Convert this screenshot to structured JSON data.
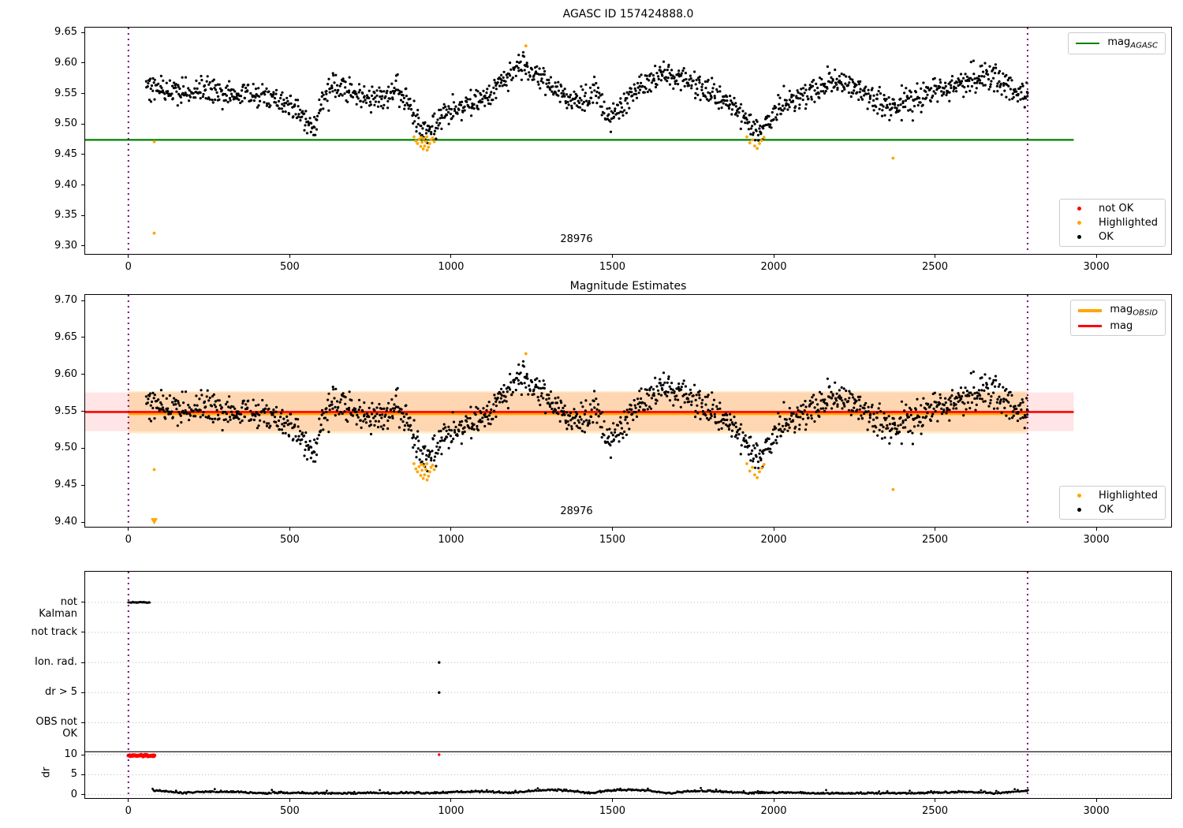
{
  "figure": {
    "background": "#ffffff",
    "accent_colors": {
      "ok_black": "#000000",
      "highlight_orange": "#ffa500",
      "not_ok_red": "#ff0000",
      "agasc_green": "#008000",
      "obsid_vline_purple": "#800080",
      "grid_gray": "#b5b5b5"
    }
  },
  "chart_data": [
    {
      "type": "scatter",
      "title": "AGASC ID 157424888.0",
      "xlim": [
        -134,
        3232
      ],
      "ylim": [
        9.287,
        9.658
      ],
      "xtick_values": [
        0,
        500,
        1000,
        1500,
        2000,
        2500,
        3000
      ],
      "xtick_labels": [
        "0",
        "500",
        "1000",
        "1500",
        "2000",
        "2500",
        "3000"
      ],
      "ytick_values": [
        9.3,
        9.35,
        9.4,
        9.45,
        9.5,
        9.55,
        9.6,
        9.65
      ],
      "ytick_labels": [
        "9.30",
        "9.35",
        "9.40",
        "9.45",
        "9.50",
        "9.55",
        "9.60",
        "9.65"
      ],
      "obsid_label": {
        "text": "28976",
        "x": 1390,
        "y": 9.308
      },
      "vlines": [
        {
          "x": 0
        },
        {
          "x": 2787
        }
      ],
      "vline_color": "#800080",
      "hlines": [
        {
          "name": "mag-agasc-line",
          "y": 9.474,
          "x0": -134,
          "x1": 2930,
          "color": "#008000",
          "width": 2.2
        }
      ],
      "ok_series": {
        "name": "OK",
        "color": "#000000",
        "sigma": 0.0105,
        "n": 1500,
        "x_start": 55,
        "x_end": 2788,
        "seed": 42,
        "trend": [
          [
            55,
            9.562
          ],
          [
            120,
            9.556
          ],
          [
            200,
            9.555
          ],
          [
            280,
            9.552
          ],
          [
            360,
            9.548
          ],
          [
            430,
            9.543
          ],
          [
            470,
            9.537
          ],
          [
            510,
            9.528
          ],
          [
            545,
            9.508
          ],
          [
            570,
            9.492
          ],
          [
            585,
            9.508
          ],
          [
            600,
            9.545
          ],
          [
            630,
            9.556
          ],
          [
            665,
            9.559
          ],
          [
            695,
            9.552
          ],
          [
            720,
            9.543
          ],
          [
            760,
            9.541
          ],
          [
            800,
            9.548
          ],
          [
            840,
            9.551
          ],
          [
            870,
            9.53
          ],
          [
            895,
            9.505
          ],
          [
            915,
            9.487
          ],
          [
            935,
            9.49
          ],
          [
            960,
            9.503
          ],
          [
            1000,
            9.517
          ],
          [
            1040,
            9.528
          ],
          [
            1080,
            9.538
          ],
          [
            1120,
            9.548
          ],
          [
            1160,
            9.568
          ],
          [
            1200,
            9.59
          ],
          [
            1225,
            9.595
          ],
          [
            1260,
            9.578
          ],
          [
            1300,
            9.57
          ],
          [
            1335,
            9.556
          ],
          [
            1365,
            9.539
          ],
          [
            1395,
            9.533
          ],
          [
            1425,
            9.547
          ],
          [
            1455,
            9.551
          ],
          [
            1478,
            9.52
          ],
          [
            1495,
            9.512
          ],
          [
            1520,
            9.526
          ],
          [
            1550,
            9.538
          ],
          [
            1590,
            9.562
          ],
          [
            1630,
            9.578
          ],
          [
            1665,
            9.588
          ],
          [
            1695,
            9.577
          ],
          [
            1735,
            9.572
          ],
          [
            1775,
            9.559
          ],
          [
            1815,
            9.548
          ],
          [
            1855,
            9.537
          ],
          [
            1895,
            9.519
          ],
          [
            1930,
            9.498
          ],
          [
            1955,
            9.489
          ],
          [
            1985,
            9.503
          ],
          [
            2015,
            9.525
          ],
          [
            2055,
            9.54
          ],
          [
            2100,
            9.547
          ],
          [
            2150,
            9.559
          ],
          [
            2195,
            9.572
          ],
          [
            2235,
            9.563
          ],
          [
            2275,
            9.553
          ],
          [
            2320,
            9.536
          ],
          [
            2365,
            9.527
          ],
          [
            2400,
            9.537
          ],
          [
            2450,
            9.546
          ],
          [
            2500,
            9.552
          ],
          [
            2550,
            9.562
          ],
          [
            2600,
            9.571
          ],
          [
            2650,
            9.578
          ],
          [
            2695,
            9.572
          ],
          [
            2740,
            9.564
          ],
          [
            2788,
            9.551
          ]
        ]
      },
      "highlighted_series": {
        "name": "Highlighted",
        "color": "#ffa500",
        "points": [
          [
            80,
            9.471
          ],
          [
            80,
            9.321
          ],
          [
            1232,
            9.628
          ],
          [
            2370,
            9.444
          ],
          [
            885,
            9.479
          ],
          [
            891,
            9.472
          ],
          [
            896,
            9.468
          ],
          [
            901,
            9.475
          ],
          [
            906,
            9.463
          ],
          [
            910,
            9.47
          ],
          [
            914,
            9.459
          ],
          [
            918,
            9.464
          ],
          [
            922,
            9.471
          ],
          [
            926,
            9.457
          ],
          [
            930,
            9.462
          ],
          [
            934,
            9.468
          ],
          [
            938,
            9.474
          ],
          [
            943,
            9.477
          ],
          [
            948,
            9.471
          ],
          [
            916,
            9.476
          ],
          [
            908,
            9.478
          ],
          [
            925,
            9.479
          ],
          [
            1917,
            9.479
          ],
          [
            1926,
            9.469
          ],
          [
            1934,
            9.474
          ],
          [
            1941,
            9.464
          ],
          [
            1949,
            9.46
          ],
          [
            1956,
            9.468
          ],
          [
            1963,
            9.473
          ],
          [
            1970,
            9.478
          ]
        ]
      },
      "legend_line": {
        "items": [
          {
            "sample": "line",
            "color": "#008000",
            "width": 2.5,
            "label": "mag",
            "sublabel": "AGASC"
          }
        ]
      },
      "legend_markers": {
        "items": [
          {
            "sample": "dot",
            "color": "#ff0000",
            "label": "not OK"
          },
          {
            "sample": "dot",
            "color": "#ffa500",
            "label": "Highlighted"
          },
          {
            "sample": "dot",
            "color": "#000000",
            "label": "OK"
          }
        ]
      }
    },
    {
      "type": "scatter",
      "title": "Magnitude Estimates",
      "xlim": [
        -134,
        3232
      ],
      "ylim": [
        9.3936,
        9.7075
      ],
      "xtick_values": [
        0,
        500,
        1000,
        1500,
        2000,
        2500,
        3000
      ],
      "xtick_labels": [
        "0",
        "500",
        "1000",
        "1500",
        "2000",
        "2500",
        "3000"
      ],
      "ytick_values": [
        9.4,
        9.45,
        9.5,
        9.55,
        9.6,
        9.65,
        9.7
      ],
      "ytick_labels": [
        "9.40",
        "9.45",
        "9.50",
        "9.55",
        "9.60",
        "9.65",
        "9.70"
      ],
      "obsid_label": {
        "text": "28976",
        "x": 1390,
        "y": 9.412
      },
      "vlines": [
        {
          "x": 0
        },
        {
          "x": 2787
        }
      ],
      "vline_color": "#800080",
      "bands": [
        {
          "name": "mag-std-band",
          "y0": 9.523,
          "y1": 9.5755,
          "x0": -134,
          "x1": 2930,
          "color": "255,0,0",
          "alpha": 0.1
        },
        {
          "name": "obsid-std-band",
          "y0": 9.52,
          "y1": 9.577,
          "x0": 0,
          "x1": 2787,
          "color": "255,165,0",
          "alpha": 0.22
        }
      ],
      "hlines": [
        {
          "name": "mag-obsid-line",
          "y": 9.547,
          "x0": 0,
          "x1": 2787,
          "color": "#ffa500",
          "width": 4
        },
        {
          "name": "mag-line",
          "y": 9.549,
          "x0": -134,
          "x1": 2930,
          "color": "#ff0000",
          "width": 2.6
        }
      ],
      "ok_series": {
        "share_from": 0,
        "color": "#000000"
      },
      "highlighted_series": {
        "name": "Highlighted",
        "color": "#ffa500",
        "points": [
          [
            80,
            9.471
          ],
          [
            1232,
            9.628
          ],
          [
            2370,
            9.444
          ],
          [
            885,
            9.479
          ],
          [
            891,
            9.472
          ],
          [
            896,
            9.468
          ],
          [
            901,
            9.475
          ],
          [
            906,
            9.463
          ],
          [
            910,
            9.47
          ],
          [
            914,
            9.459
          ],
          [
            918,
            9.464
          ],
          [
            922,
            9.471
          ],
          [
            926,
            9.457
          ],
          [
            930,
            9.462
          ],
          [
            934,
            9.468
          ],
          [
            938,
            9.474
          ],
          [
            943,
            9.477
          ],
          [
            948,
            9.471
          ],
          [
            916,
            9.476
          ],
          [
            908,
            9.478
          ],
          [
            925,
            9.479
          ],
          [
            1917,
            9.479
          ],
          [
            1926,
            9.469
          ],
          [
            1934,
            9.474
          ],
          [
            1941,
            9.464
          ],
          [
            1949,
            9.46
          ],
          [
            1956,
            9.468
          ],
          [
            1963,
            9.473
          ],
          [
            1970,
            9.478
          ]
        ]
      },
      "clip_markers": [
        {
          "x": 80,
          "y": 9.401,
          "direction": "down",
          "color": "#ffa500"
        }
      ],
      "legend_line": {
        "items": [
          {
            "sample": "line",
            "color": "#ffa500",
            "width": 4,
            "label": "mag",
            "sublabel": "OBSID"
          },
          {
            "sample": "line",
            "color": "#ff0000",
            "width": 3,
            "label": "mag",
            "sublabel": ""
          }
        ]
      },
      "legend_markers": {
        "items": [
          {
            "sample": "dot",
            "color": "#ffa500",
            "label": "Highlighted"
          },
          {
            "sample": "dot",
            "color": "#000000",
            "label": "OK"
          }
        ]
      }
    },
    {
      "type": "flags",
      "title": "",
      "xlim": [
        -134,
        3232
      ],
      "ylim": [
        0.49,
        8.02
      ],
      "xtick_values": [
        0,
        500,
        1000,
        1500,
        2000,
        2500,
        3000
      ],
      "xtick_labels": [
        "0",
        "500",
        "1000",
        "1500",
        "2000",
        "2500",
        "3000"
      ],
      "categories": [
        {
          "label": "not Kalman",
          "y": 7
        },
        {
          "label": "not track",
          "y": 6
        },
        {
          "label": "Ion. rad.",
          "y": 5
        },
        {
          "label": "dr > 5",
          "y": 4
        },
        {
          "label": "OBS not OK",
          "y": 3
        }
      ],
      "dr_axis": {
        "label": "dr",
        "ticks": [
          10,
          5,
          0
        ],
        "tick_labels": [
          "10",
          "5",
          "0"
        ],
        "y0": 0.6,
        "scale": 0.1332
      },
      "separator_line_y": 2.03,
      "vlines": [
        {
          "x": 0
        },
        {
          "x": 2787
        }
      ],
      "vline_color": "#800080",
      "grid_color": "#b5b5b5",
      "runs": [
        {
          "name": "not-kalman-run",
          "category_y": 7,
          "x0": 0,
          "x1": 66,
          "n": 30,
          "color": "#000000",
          "r": 1.4
        },
        {
          "name": "dr-clip-run",
          "dr0": 9.6,
          "dr1": 9.95,
          "x0": 0,
          "x1": 81,
          "n": 42,
          "color": "#ff0000",
          "r": 2.3
        }
      ],
      "flag_points": [
        {
          "x": 963,
          "category_y": 5,
          "color": "#000000"
        },
        {
          "x": 963,
          "category_y": 4,
          "color": "#000000"
        },
        {
          "x": 963,
          "dr": 10,
          "color": "#ff0000"
        }
      ],
      "dr_series": {
        "name": "dr",
        "color": "#000000",
        "x_start": 75,
        "x_end": 2788,
        "n": 860,
        "seed": 7,
        "r": 1.4
      }
    }
  ]
}
